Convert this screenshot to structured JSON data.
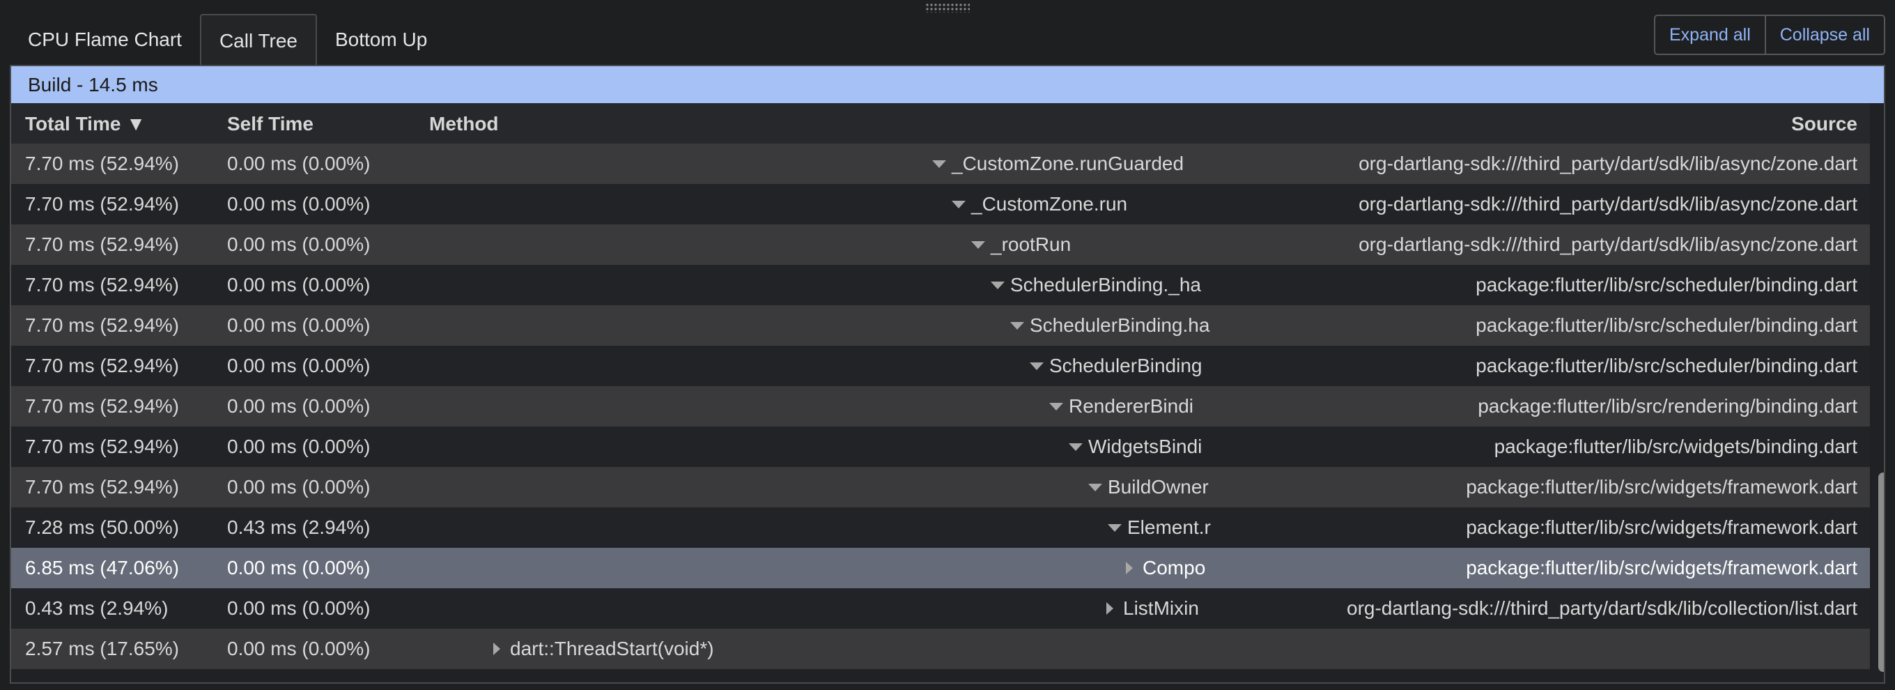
{
  "tabs": [
    {
      "label": "CPU Flame Chart",
      "active": false
    },
    {
      "label": "Call Tree",
      "active": true
    },
    {
      "label": "Bottom Up",
      "active": false
    }
  ],
  "buttons": {
    "expand_all": "Expand all",
    "collapse_all": "Collapse all"
  },
  "build_bar": {
    "label": "Build - 14.5 ms"
  },
  "columns": {
    "total": "Total Time ▼",
    "self": "Self Time",
    "method": "Method",
    "source": "Source"
  },
  "rows": [
    {
      "total": "7.70 ms (52.94%)",
      "self": "0.00 ms (0.00%)",
      "method": "_CustomZone.runGuarded",
      "source": "org-dartlang-sdk:///third_party/dart/sdk/lib/async/zone.dart",
      "expanded": true
    },
    {
      "total": "7.70 ms (52.94%)",
      "self": "0.00 ms (0.00%)",
      "method": "_CustomZone.run",
      "source": "org-dartlang-sdk:///third_party/dart/sdk/lib/async/zone.dart",
      "expanded": true
    },
    {
      "total": "7.70 ms (52.94%)",
      "self": "0.00 ms (0.00%)",
      "method": "_rootRun",
      "source": "org-dartlang-sdk:///third_party/dart/sdk/lib/async/zone.dart",
      "expanded": true
    },
    {
      "total": "7.70 ms (52.94%)",
      "self": "0.00 ms (0.00%)",
      "method": "SchedulerBinding._ha",
      "source": "package:flutter/lib/src/scheduler/binding.dart",
      "expanded": true
    },
    {
      "total": "7.70 ms (52.94%)",
      "self": "0.00 ms (0.00%)",
      "method": "SchedulerBinding.ha",
      "source": "package:flutter/lib/src/scheduler/binding.dart",
      "expanded": true
    },
    {
      "total": "7.70 ms (52.94%)",
      "self": "0.00 ms (0.00%)",
      "method": "SchedulerBinding",
      "source": "package:flutter/lib/src/scheduler/binding.dart",
      "expanded": true
    },
    {
      "total": "7.70 ms (52.94%)",
      "self": "0.00 ms (0.00%)",
      "method": "RendererBindi",
      "source": "package:flutter/lib/src/rendering/binding.dart",
      "expanded": true
    },
    {
      "total": "7.70 ms (52.94%)",
      "self": "0.00 ms (0.00%)",
      "method": "WidgetsBindi",
      "source": "package:flutter/lib/src/widgets/binding.dart",
      "expanded": true
    },
    {
      "total": "7.70 ms (52.94%)",
      "self": "0.00 ms (0.00%)",
      "method": "BuildOwner",
      "source": "package:flutter/lib/src/widgets/framework.dart",
      "expanded": true
    },
    {
      "total": "7.28 ms (50.00%)",
      "self": "0.43 ms (2.94%)",
      "method": "Element.r",
      "source": "package:flutter/lib/src/widgets/framework.dart",
      "expanded": true
    },
    {
      "total": "6.85 ms (47.06%)",
      "self": "0.00 ms (0.00%)",
      "method": "Compo",
      "source": "package:flutter/lib/src/widgets/framework.dart",
      "expanded": false,
      "selected": true
    },
    {
      "total": "0.43 ms (2.94%)",
      "self": "0.00 ms (0.00%)",
      "method": "ListMixin",
      "source": "org-dartlang-sdk:///third_party/dart/sdk/lib/collection/list.dart",
      "expanded": false
    },
    {
      "total": "2.57 ms (17.65%)",
      "self": "0.00 ms (0.00%)",
      "method": "dart::ThreadStart(void*)",
      "source": "",
      "expanded": false
    }
  ]
}
